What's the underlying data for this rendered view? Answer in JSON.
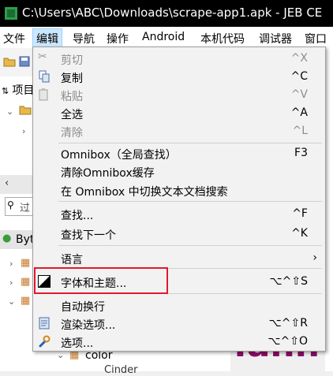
{
  "window": {
    "title": "C:\\Users\\ABC\\Downloads\\scrape-app1.apk - JEB CE"
  },
  "menubar": {
    "items": [
      "文件",
      "编辑",
      "导航",
      "操作",
      "Android",
      "本机代码",
      "调试器",
      "窗口"
    ]
  },
  "background": {
    "project_label": "项目",
    "filter_placeholder": "过",
    "bytecode_label": "Byt",
    "color_node": "color",
    "partial_node": "Cinder",
    "editor_text": ".ann"
  },
  "edit_menu": {
    "cut": {
      "label": "剪切",
      "shortcut": "^X"
    },
    "copy": {
      "label": "复制",
      "shortcut": "^C"
    },
    "paste": {
      "label": "粘贴",
      "shortcut": "^V"
    },
    "select_all": {
      "label": "全选",
      "shortcut": "^A"
    },
    "clear": {
      "label": "清除",
      "shortcut": "^L"
    },
    "omnibox": {
      "label": "Omnibox（全局查找）",
      "shortcut": "F3"
    },
    "clear_omnibox": {
      "label": "清除Omnibox缓存",
      "shortcut": ""
    },
    "toggle_search": {
      "label": "在 Omnibox 中切换文本文档搜索",
      "shortcut": ""
    },
    "find": {
      "label": "查找...",
      "shortcut": "^F"
    },
    "find_next": {
      "label": "查找下一个",
      "shortcut": "^K"
    },
    "language": {
      "label": "语言",
      "shortcut": "›"
    },
    "fonts_themes": {
      "label": "字体和主题...",
      "shortcut": "⌥^⇧S"
    },
    "word_wrap": {
      "label": "自动换行",
      "shortcut": ""
    },
    "render_options": {
      "label": "渲染选项...",
      "shortcut": "⌥^⇧R"
    },
    "options": {
      "label": "选项...",
      "shortcut": "⌥^⇧O"
    }
  },
  "colors": {
    "highlight": "#e0192e",
    "menu_active": "#cce8ff",
    "editor_keyword": "#8b0a68"
  }
}
